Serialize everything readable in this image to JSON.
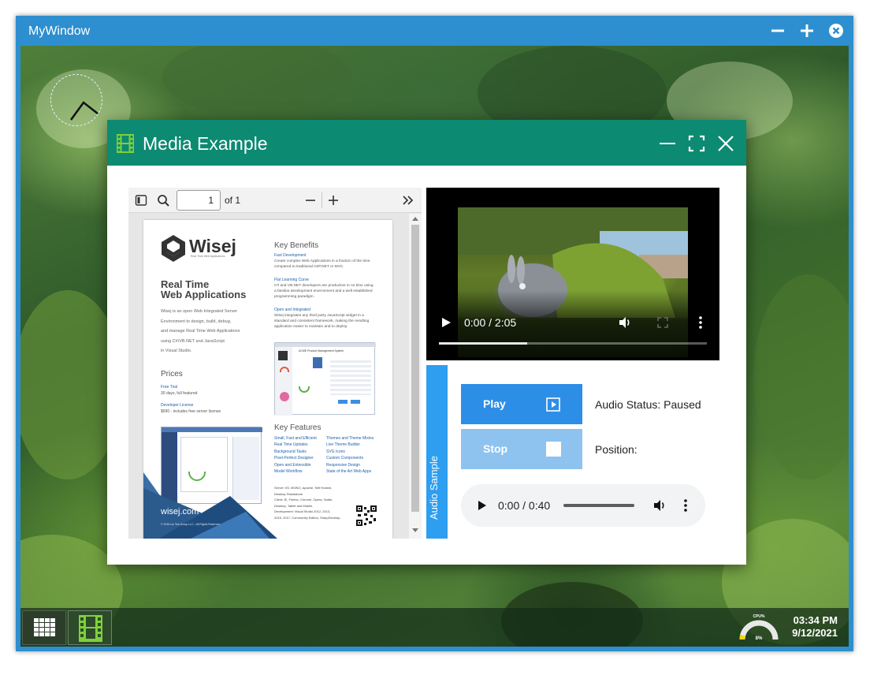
{
  "outer_window": {
    "title": "MyWindow"
  },
  "media_window": {
    "title": "Media Example"
  },
  "pdf_viewer": {
    "page_number": "1",
    "page_total_label": "of 1",
    "document": {
      "brand": "Wisej",
      "brand_tagline": "Real Time Web Applications",
      "headline_line1": "Real Time",
      "headline_line2": "Web Applications",
      "intro": [
        "Wisej is an open Web Integrated Server",
        "Environment to design, build, debug,",
        "and manage Real Time Web Applications",
        "using C#/VB.NET and JavaScript",
        "in Visual Studio."
      ],
      "prices_heading": "Prices",
      "free_trial": "Free Trial",
      "free_trial_desc": "30 days, full featured",
      "developer_license": "Developer License",
      "developer_license_desc": "$690 - includes free server license",
      "website": "wisej.com",
      "key_benefits_heading": "Key Benefits",
      "benefits": [
        {
          "title": "Fast Development",
          "lines": [
            "Create complex Web Applications in a fraction of the time",
            "compared to traditional ASP.NET or MVC."
          ]
        },
        {
          "title": "Flat Learning Curve",
          "lines": [
            "C# and VB.NET developers are productive in no time using",
            "a familiar development environment and a well established",
            "programming paradigm."
          ]
        },
        {
          "title": "Open and Integrated",
          "lines": [
            "Wisej integrates any third party JavaScript widget in a",
            "standard and consistent framework, making the resulting",
            "application easier to maintain and to deploy."
          ]
        }
      ],
      "key_features_heading": "Key Features",
      "features_left": [
        "Small, Fast and Efficient",
        "Real Time Updates",
        "Background Tasks",
        "Pixel-Perfect Designer",
        "Open and Extensible",
        "Model Workflow"
      ],
      "features_right": [
        "Themes and Theme Mixins",
        "Live Theme Builder",
        "SVG Icons",
        "Custom Components",
        "Responsive Design",
        "State of the Art Web Apps"
      ],
      "requirements": [
        "Server: IIS, MONO, Apache, Self Hosted,",
        "Desktop Standalone.",
        "Client: IE, Firefox, Chrome, Opera, Safari,",
        "Desktop, Tablet and Mobile.",
        "Development: Visual Studio 2012, 2013,",
        "2015, 2017, Community Edition, SharpDevelop."
      ],
      "copyright": "© 2016 Ice Tea Group LLC - All Rights Reserved",
      "screenshot_title": "ACME Product Management System"
    }
  },
  "video_player": {
    "time": "0:00 / 2:05",
    "progress_fraction": 0.33
  },
  "audio_panel": {
    "tab_label": "Audio Sample",
    "play_label": "Play",
    "stop_label": "Stop",
    "status_label": "Audio Status: Paused",
    "position_label": "Position:",
    "player_time": "0:00 / 0:40"
  },
  "taskbar": {
    "cpu_label": "CPU%",
    "cpu_value": "8%",
    "cpu_fraction": 0.08,
    "time": "03:34 PM",
    "date": "9/12/2021"
  },
  "colors": {
    "outer_frame": "#2d8fcf",
    "media_titlebar": "#0d8a72",
    "play_button": "#2d8ee8",
    "stop_button": "#8ec3ef",
    "audio_tab": "#2d9ef0"
  }
}
